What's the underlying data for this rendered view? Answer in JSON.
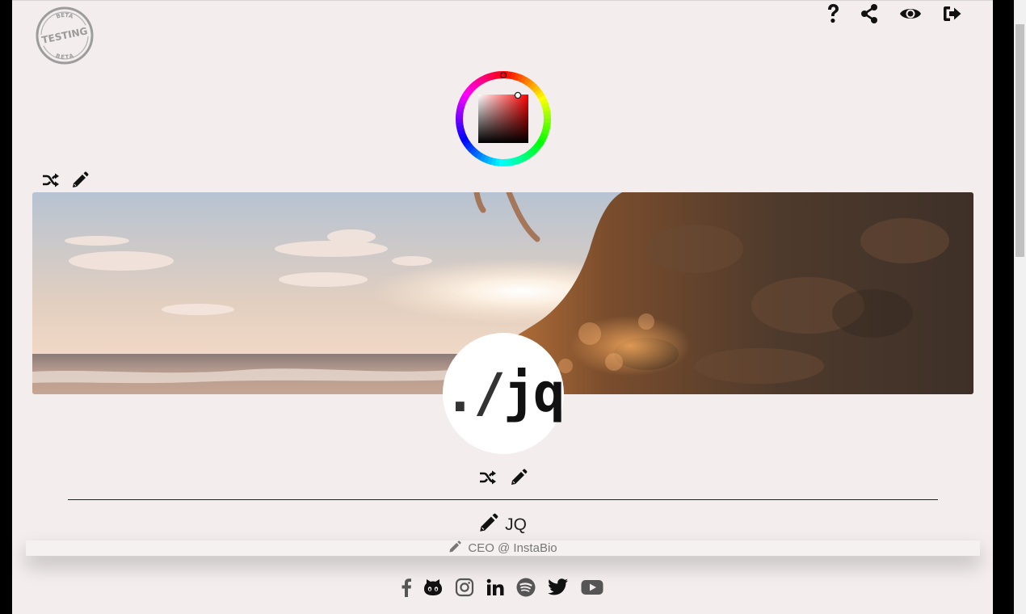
{
  "stamp": {
    "top_text": "BETA",
    "center_text": "TESTING",
    "bottom_text": "BETA"
  },
  "top_actions": [
    {
      "name": "help",
      "icon": "question-icon"
    },
    {
      "name": "share",
      "icon": "share-icon"
    },
    {
      "name": "preview",
      "icon": "eye-icon"
    },
    {
      "name": "logout",
      "icon": "sign-out-icon"
    }
  ],
  "color_picker": {
    "selected_hue": "#ff0000"
  },
  "cover_tools": {
    "shuffle_icon": "shuffle-icon",
    "edit_icon": "pencil-icon"
  },
  "avatar": {
    "prefix": "./",
    "text": "jq"
  },
  "avatar_tools": {
    "shuffle_icon": "shuffle-icon",
    "edit_icon": "pencil-icon"
  },
  "profile": {
    "name": "JQ",
    "title": "CEO @ InstaBio"
  },
  "socials": [
    {
      "name": "facebook",
      "icon": "facebook-icon"
    },
    {
      "name": "github",
      "icon": "github-icon"
    },
    {
      "name": "instagram",
      "icon": "instagram-icon"
    },
    {
      "name": "linkedin",
      "icon": "linkedin-icon"
    },
    {
      "name": "spotify",
      "icon": "spotify-icon"
    },
    {
      "name": "twitter",
      "icon": "twitter-icon"
    },
    {
      "name": "youtube",
      "icon": "youtube-icon"
    }
  ],
  "colors": {
    "background": "#f3eded",
    "icon": "#111111",
    "muted": "#777777"
  }
}
